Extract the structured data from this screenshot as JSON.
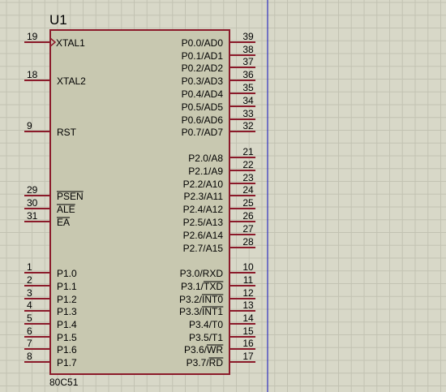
{
  "component": {
    "ref": "U1",
    "part": "80C51"
  },
  "colors": {
    "background": "#d8d8c8",
    "grid": "#c2c2b2",
    "body_fill": "#c8c8b0",
    "body_stroke": "#8b1a2a",
    "pin_line": "#8b1a2a",
    "cursor_line": "#3030c0"
  },
  "left_pins": [
    {
      "num": "19",
      "label": "XTAL1",
      "clock": true
    },
    {
      "num": "18",
      "label": "XTAL2"
    },
    {
      "num": "9",
      "label": "RST"
    },
    {
      "num": "29",
      "label": "PSEN",
      "overline": true
    },
    {
      "num": "30",
      "label": "ALE",
      "overline": true
    },
    {
      "num": "31",
      "label": "EA",
      "overline": true
    },
    {
      "num": "1",
      "label": "P1.0"
    },
    {
      "num": "2",
      "label": "P1.1"
    },
    {
      "num": "3",
      "label": "P1.2"
    },
    {
      "num": "4",
      "label": "P1.3"
    },
    {
      "num": "5",
      "label": "P1.4"
    },
    {
      "num": "6",
      "label": "P1.5"
    },
    {
      "num": "7",
      "label": "P1.6"
    },
    {
      "num": "8",
      "label": "P1.7"
    }
  ],
  "right_pins": [
    {
      "num": "39",
      "label": "P0.0/AD0"
    },
    {
      "num": "38",
      "label": "P0.1/AD1"
    },
    {
      "num": "37",
      "label": "P0.2/AD2"
    },
    {
      "num": "36",
      "label": "P0.3/AD3"
    },
    {
      "num": "35",
      "label": "P0.4/AD4"
    },
    {
      "num": "34",
      "label": "P0.5/AD5"
    },
    {
      "num": "33",
      "label": "P0.6/AD6"
    },
    {
      "num": "32",
      "label": "P0.7/AD7"
    },
    {
      "num": "21",
      "label": "P2.0/A8"
    },
    {
      "num": "22",
      "label": "P2.1/A9"
    },
    {
      "num": "23",
      "label": "P2.2/A10"
    },
    {
      "num": "24",
      "label": "P2.3/A11"
    },
    {
      "num": "25",
      "label": "P2.4/A12"
    },
    {
      "num": "26",
      "label": "P2.5/A13"
    },
    {
      "num": "27",
      "label": "P2.6/A14"
    },
    {
      "num": "28",
      "label": "P2.7/A15"
    },
    {
      "num": "10",
      "label": "P3.0/RXD"
    },
    {
      "num": "11",
      "label": "P3.1/",
      "label_over": "TXD"
    },
    {
      "num": "12",
      "label": "P3.2/",
      "label_over": "INT0"
    },
    {
      "num": "13",
      "label": "P3.3/",
      "label_over": "INT1"
    },
    {
      "num": "14",
      "label": "P3.4/T0"
    },
    {
      "num": "15",
      "label": "P3.5/T1"
    },
    {
      "num": "16",
      "label": "P3.6/",
      "label_over": "WR"
    },
    {
      "num": "17",
      "label": "P3.7/",
      "label_over": "RD"
    }
  ]
}
